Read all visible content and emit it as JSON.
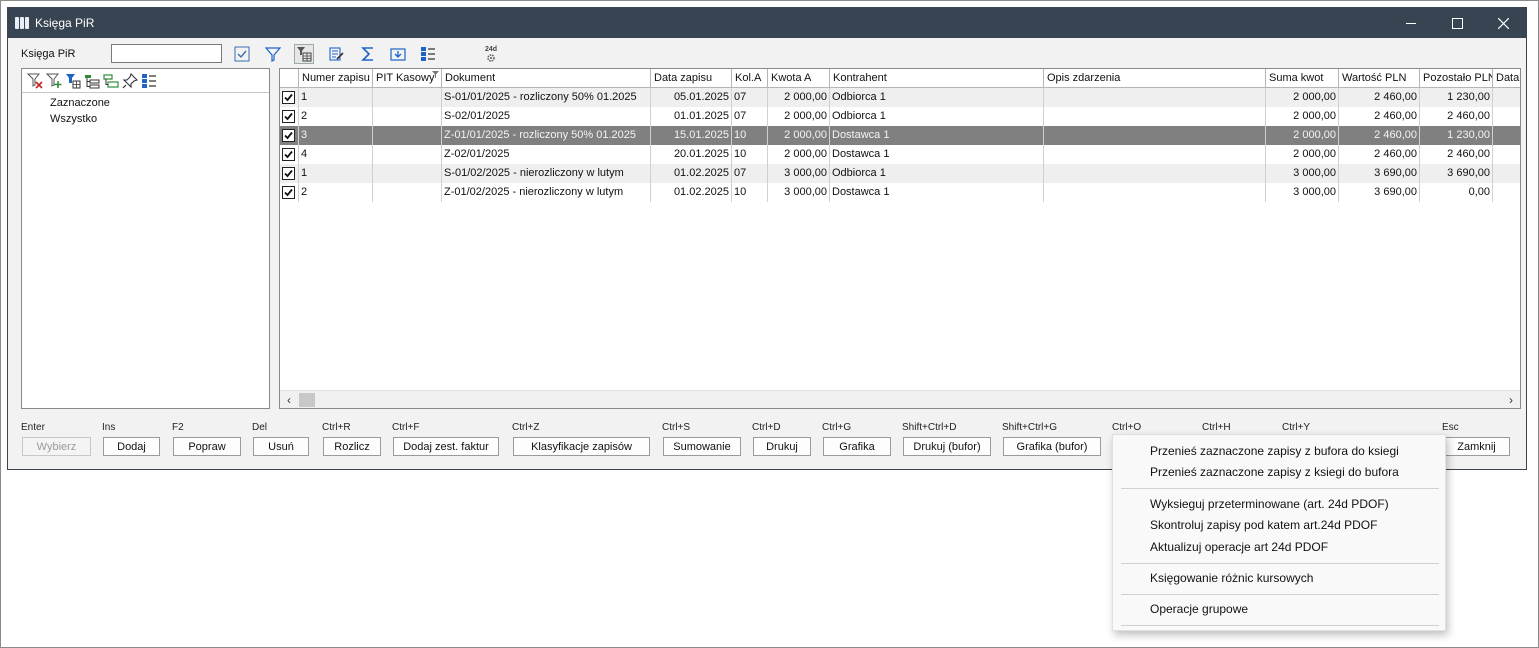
{
  "window": {
    "title": "Księga PiR"
  },
  "toolbar": {
    "label": "Księga PiR",
    "search_value": "",
    "icon_24d_label": "24d"
  },
  "tree": {
    "items": [
      "Zaznaczone",
      "Wszystko"
    ]
  },
  "grid": {
    "columns": [
      "Numer zapisu",
      "PIT Kasowy",
      "Dokument",
      "Data zapisu",
      "Kol.A",
      "Kwota A",
      "Kontrahent",
      "Opis zdarzenia",
      "Suma kwot",
      "Wartość PLN",
      "Pozostało PLN",
      "Data"
    ],
    "rows": [
      {
        "checked": true,
        "numer": "1",
        "pit": "",
        "dokument": "S-01/01/2025 - rozliczony 50% 01.2025",
        "data": "05.01.2025",
        "kol": "07",
        "kwota": "2 000,00",
        "kontrahent": "Odbiorca 1",
        "opis": "",
        "suma": "2 000,00",
        "wartosc": "2 460,00",
        "pozostalo": "1 230,00",
        "data2": ""
      },
      {
        "checked": true,
        "numer": "2",
        "pit": "",
        "dokument": "S-02/01/2025",
        "data": "01.01.2025",
        "kol": "07",
        "kwota": "2 000,00",
        "kontrahent": "Odbiorca 1",
        "opis": "",
        "suma": "2 000,00",
        "wartosc": "2 460,00",
        "pozostalo": "2 460,00",
        "data2": ""
      },
      {
        "checked": true,
        "numer": "3",
        "pit": "",
        "dokument": "Z-01/01/2025 - rozliczony 50% 01.2025",
        "data": "15.01.2025",
        "kol": "10",
        "kwota": "2 000,00",
        "kontrahent": "Dostawca 1",
        "opis": "",
        "suma": "2 000,00",
        "wartosc": "2 460,00",
        "pozostalo": "1 230,00",
        "data2": ""
      },
      {
        "checked": true,
        "numer": "4",
        "pit": "",
        "dokument": "Z-02/01/2025",
        "data": "20.01.2025",
        "kol": "10",
        "kwota": "2 000,00",
        "kontrahent": "Dostawca 1",
        "opis": "",
        "suma": "2 000,00",
        "wartosc": "2 460,00",
        "pozostalo": "2 460,00",
        "data2": ""
      },
      {
        "checked": true,
        "numer": "1",
        "pit": "",
        "dokument": "S-01/02/2025 - nierozliczony w lutym",
        "data": "01.02.2025",
        "kol": "07",
        "kwota": "3 000,00",
        "kontrahent": "Odbiorca 1",
        "opis": "",
        "suma": "3 000,00",
        "wartosc": "3 690,00",
        "pozostalo": "3 690,00",
        "data2": ""
      },
      {
        "checked": true,
        "numer": "2",
        "pit": "",
        "dokument": "Z-01/02/2025 - nierozliczony w lutym",
        "data": "01.02.2025",
        "kol": "10",
        "kwota": "3 000,00",
        "kontrahent": "Dostawca 1",
        "opis": "",
        "suma": "3 000,00",
        "wartosc": "3 690,00",
        "pozostalo": "0,00",
        "data2": ""
      }
    ],
    "selected_row": 2
  },
  "shortcuts": [
    "Enter",
    "Ins",
    "F2",
    "Del",
    "Ctrl+R",
    "Ctrl+F",
    "Ctrl+Z",
    "Ctrl+S",
    "Ctrl+D",
    "Ctrl+G",
    "Shift+Ctrl+D",
    "Shift+Ctrl+G",
    "Ctrl+O",
    "Ctrl+H",
    "Ctrl+Y",
    "Esc"
  ],
  "buttons": {
    "wybierz": "Wybierz",
    "dodaj": "Dodaj",
    "popraw": "Popraw",
    "usun": "Usuń",
    "rozlicz": "Rozlicz",
    "dodaj_zest": "Dodaj zest. faktur",
    "klasyfikacje": "Klasyfikacje zapisów",
    "sumowanie": "Sumowanie",
    "drukuj": "Drukuj",
    "grafika": "Grafika",
    "drukuj_bufor": "Drukuj (bufor)",
    "grafika_bufor": "Grafika (bufor)",
    "zamknij": "Zamknij"
  },
  "context_menu": {
    "items": [
      "Przenieś zaznaczone zapisy z bufora do ksiegi",
      "Przenieś zaznaczone zapisy z ksiegi do bufora",
      "Wyksieguj przeterminowane (art. 24d PDOF)",
      "Skontroluj zapisy pod katem art.24d PDOF",
      "Aktualizuj operacje art 24d PDOF",
      "Księgowanie różnic kursowych",
      "Operacje grupowe"
    ]
  },
  "colors": {
    "titlebar": "#384452",
    "selected_row": "#808080",
    "accent_blue": "#1e64c8",
    "accent_green": "#2e8b3a",
    "accent_red": "#d02020"
  }
}
